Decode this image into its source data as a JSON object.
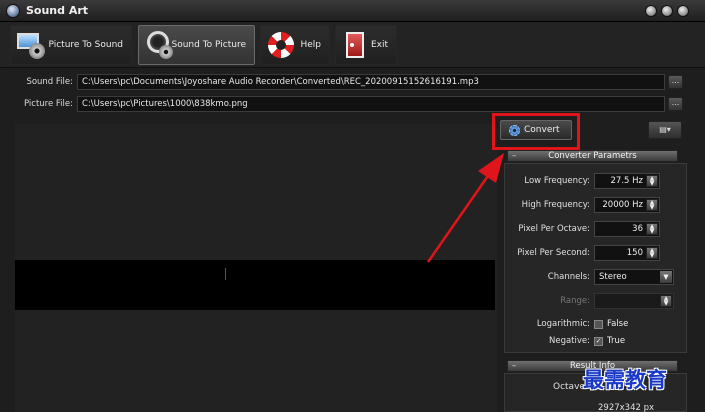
{
  "window": {
    "title": "Sound Art"
  },
  "toolbar": {
    "picture_to_sound": "Picture To Sound",
    "sound_to_picture": "Sound To Picture",
    "help": "Help",
    "exit": "Exit"
  },
  "files": {
    "sound_label": "Sound File:",
    "sound_value": "C:\\Users\\pc\\Documents\\Joyoshare Audio Recorder\\Converted\\REC_20200915152616191.mp3",
    "picture_label": "Picture File:",
    "picture_value": "C:\\Users\\pc\\Pictures\\1000\\838kmo.png",
    "browse_label": "..."
  },
  "actions": {
    "convert_label": "Convert"
  },
  "params": {
    "header": "Converter Parametrs",
    "low_freq_label": "Low Frequency:",
    "low_freq_value": "27.5 Hz",
    "high_freq_label": "High Frequency:",
    "high_freq_value": "20000 Hz",
    "ppo_label": "Pixel Per Octave:",
    "ppo_value": "36",
    "pps_label": "Pixel Per Second:",
    "pps_value": "150",
    "channels_label": "Channels:",
    "channels_value": "Stereo",
    "range_label": "Range:",
    "log_label": "Logarithmic:",
    "log_value": "False",
    "neg_label": "Negative:",
    "neg_value": "True"
  },
  "result": {
    "header": "Result Info",
    "octave_label": "Octave",
    "size_value": "2927x342 px"
  },
  "watermark": "最需教育",
  "colors": {
    "highlight": "#e0151b",
    "arrow": "#e0151b",
    "watermark": "#1a39c7"
  }
}
